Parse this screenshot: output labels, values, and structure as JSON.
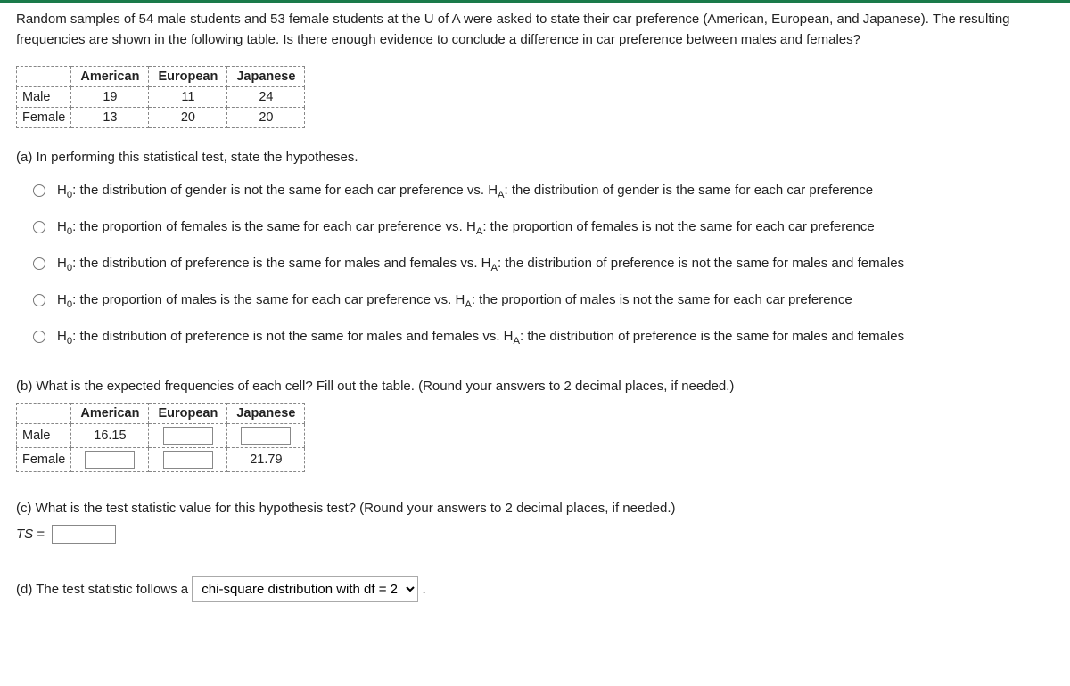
{
  "intro": "Random samples of 54 male students and 53 female students at the U of A were asked to state their car preference (American, European, and Japanese). The resulting frequencies are shown in the following table. Is there enough evidence to conclude a difference in car preference between males and females?",
  "table1": {
    "cols": [
      "American",
      "European",
      "Japanese"
    ],
    "rows": [
      {
        "label": "Male",
        "vals": [
          "19",
          "11",
          "24"
        ]
      },
      {
        "label": "Female",
        "vals": [
          "13",
          "20",
          "20"
        ]
      }
    ]
  },
  "partA": {
    "prompt": "(a) In performing this statistical test, state the hypotheses.",
    "opts": [
      "H₀: the distribution of gender is not the same for each car preference vs. H_A: the distribution of gender is the same for each car preference",
      "H₀: the proportion of females is the same for each car preference vs. H_A: the proportion of females is not the same for each car preference",
      "H₀: the distribution of preference is the same for males and females vs. H_A: the distribution of preference is not the same for males and females",
      "H₀: the proportion of males is the same for each car preference vs. H_A: the proportion of males is not the same for each car preference",
      "H₀: the distribution of preference is not the same for males and females vs. H_A: the distribution of preference is the same for males and females"
    ]
  },
  "partB": {
    "prompt": "(b) What is the expected frequencies of each cell?  Fill out the table. (Round your answers to 2 decimal places, if needed.)",
    "cols": [
      "American",
      "European",
      "Japanese"
    ],
    "rows": [
      {
        "label": "Male",
        "vals": [
          "16.15",
          "",
          ""
        ]
      },
      {
        "label": "Female",
        "vals": [
          "",
          "",
          "21.79"
        ]
      }
    ]
  },
  "partC": {
    "prompt": "(c) What is the test statistic value for this hypothesis test? (Round your answers to 2 decimal places, if needed.)",
    "label_ts": "TS",
    "equals": " = ",
    "value": ""
  },
  "partD": {
    "prefix": "(d) The test statistic follows a ",
    "selected": "chi-square distribution with df = 2",
    "suffix": " ."
  }
}
